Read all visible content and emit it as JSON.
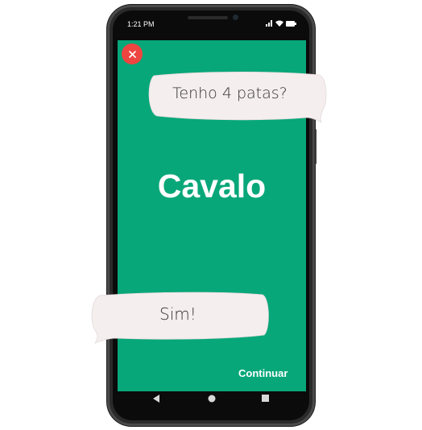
{
  "status_bar": {
    "time": "1:21 PM",
    "icons": [
      "signal-icon",
      "wifi-icon",
      "battery-icon"
    ]
  },
  "game": {
    "close_icon": "close-icon",
    "word": "Cavalo",
    "question": "Tenho 4 patas?",
    "answer": "Sim!",
    "continue_label": "Continuar"
  },
  "nav_bar": {
    "icons": [
      "back-icon",
      "home-icon",
      "recent-apps-icon"
    ]
  },
  "colors": {
    "screen_background": "#07a779",
    "close_button": "#ee4540",
    "bubble_fill": "#f4eeee",
    "text_on_screen": "#ffffff"
  }
}
